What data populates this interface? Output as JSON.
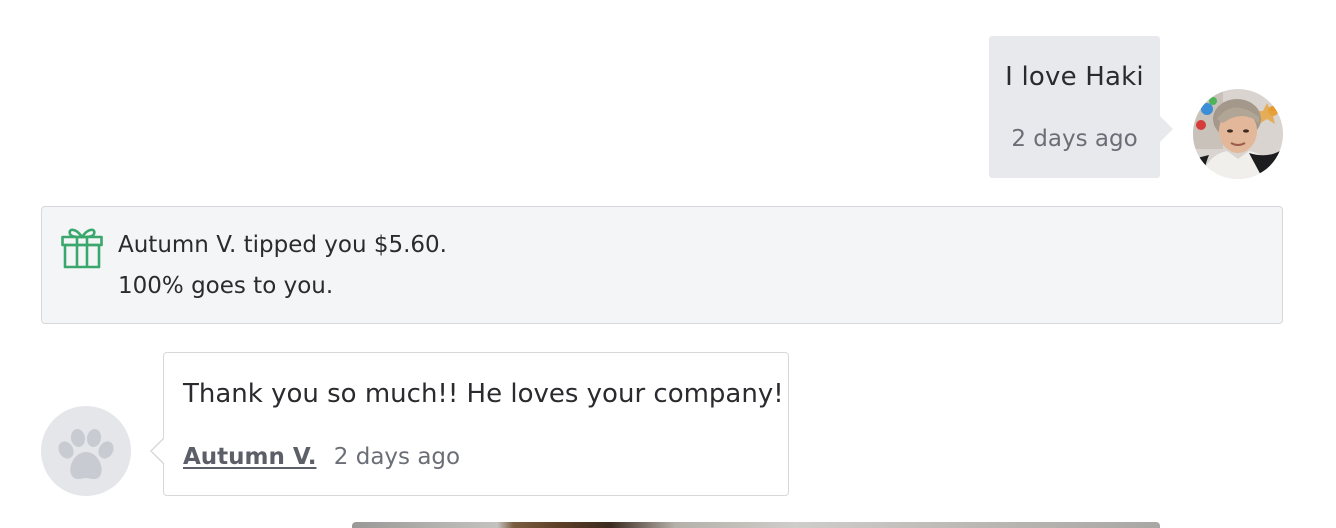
{
  "outgoing_message": {
    "text": "I love Haki",
    "time": "2 days ago"
  },
  "tip_notice": {
    "line1": "Autumn V. tipped you $5.60.",
    "line2": "100% goes to you."
  },
  "incoming_message": {
    "text": "Thank you so much!! He loves your company!",
    "author": "Autumn V.",
    "time": "2 days ago"
  },
  "icons": {
    "gift": "gift-icon",
    "paw": "paw-icon"
  },
  "colors": {
    "outgoing_bubble": "#e8e9ec",
    "tip_background": "#f4f5f6",
    "gift_green": "#3aa76d",
    "border": "#d6d8dc",
    "muted_text": "#6c6e77"
  }
}
